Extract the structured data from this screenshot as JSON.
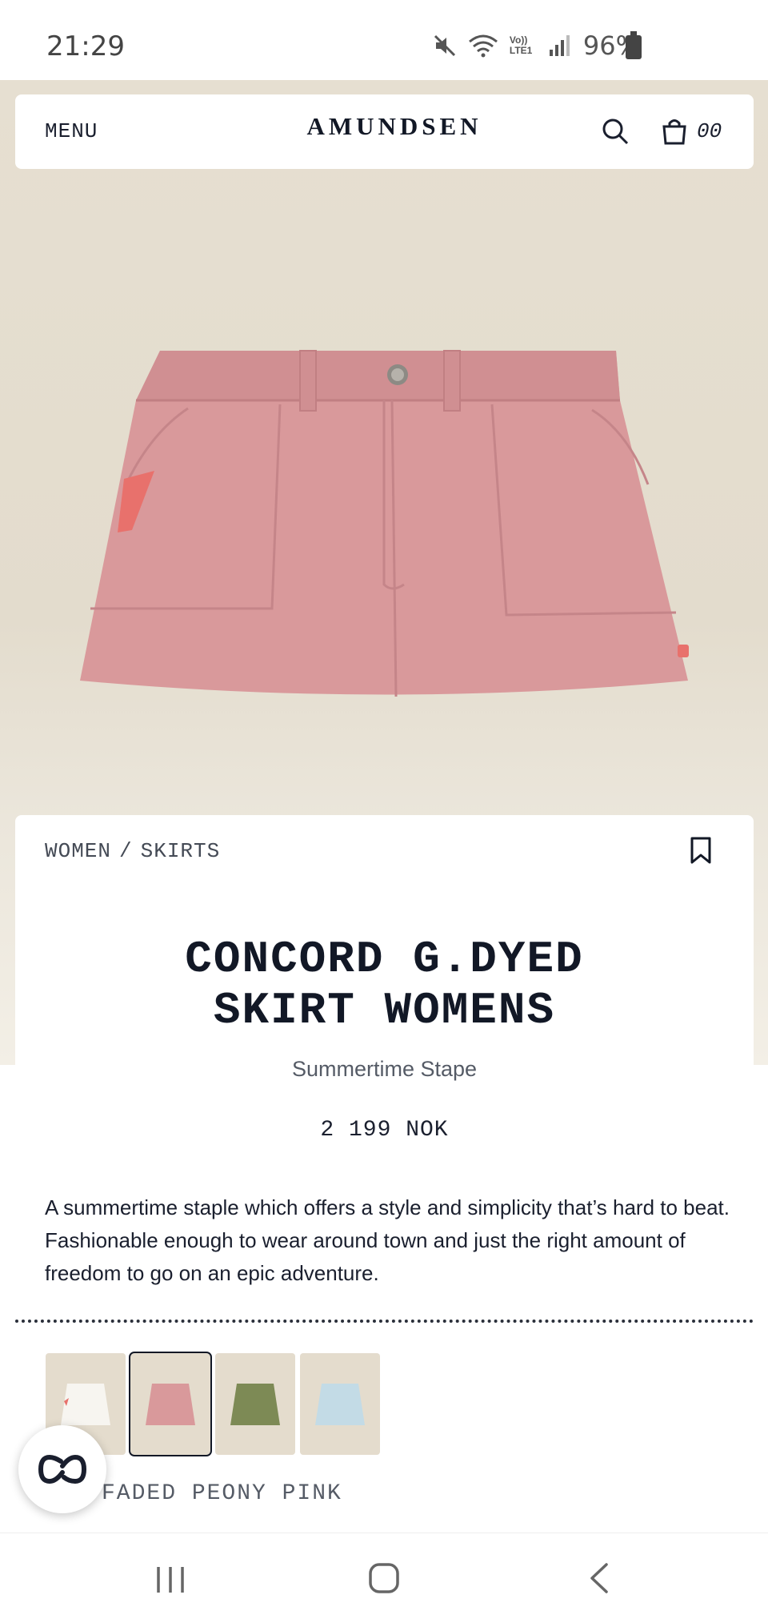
{
  "status_bar": {
    "time": "21:29",
    "battery": "96%",
    "network_label": "Vo)) LTE1"
  },
  "header": {
    "menu_label": "MENU",
    "logo": "AMUNDSEN",
    "cart_count": "00",
    "icons": [
      "search-icon",
      "bag-icon"
    ]
  },
  "breadcrumb": {
    "category": "WOMEN",
    "separator": "/",
    "subcategory": "SKIRTS"
  },
  "product": {
    "title": "CONCORD G.DYED\nSKIRT WOMENS",
    "subtitle": "Summertime Stape",
    "price": "2 199 NOK",
    "description": "A summertime staple which offers a style and simplicity that’s hard to beat. Fashionable enough to wear around town and just the right amount of freedom to go on an epic adventure.",
    "selected_color": "FADED PEONY PINK",
    "swatches": [
      {
        "color": "#f4f1ea",
        "selected": false
      },
      {
        "color": "#d9999b",
        "selected": true
      },
      {
        "color": "#7d8a55",
        "selected": false
      },
      {
        "color": "#c3dbe6",
        "selected": false
      }
    ]
  },
  "colors": {
    "skirt": "#d9999b",
    "hero_background": "#e6dfd1",
    "ink": "#121826"
  }
}
